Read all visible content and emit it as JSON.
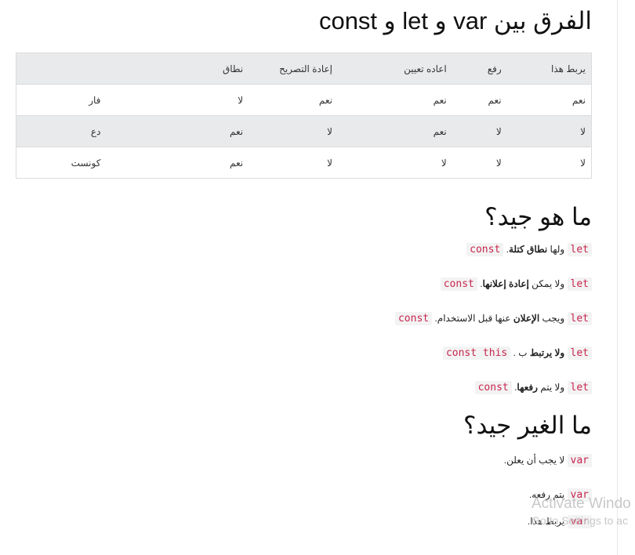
{
  "title": "الفرق بين var و let و const",
  "table": {
    "headers": [
      "يربط هذا",
      "رفع",
      "اعاده تعيين",
      "إعادة التصريح",
      "نطاق",
      ""
    ],
    "rows": [
      [
        "نعم",
        "نعم",
        "نعم",
        "نعم",
        "لا",
        "فار"
      ],
      [
        "لا",
        "لا",
        "نعم",
        "لا",
        "نعم",
        "دع"
      ],
      [
        "لا",
        "لا",
        "لا",
        "لا",
        "نعم",
        "كونست"
      ]
    ]
  },
  "good": {
    "heading": "ما هو جيد؟",
    "items": [
      {
        "code1": "let",
        "pre": " ولها ",
        "bold": "نطاق كتلة",
        "post": ". ",
        "code2": "const"
      },
      {
        "code1": "let",
        "pre": " ولا يمكن ",
        "bold": "إعادة إعلانها",
        "post": ". ",
        "code2": "const"
      },
      {
        "code1": "let",
        "pre": " ويجب ",
        "bold": "الإعلان",
        "post": " عنها قبل الاستخدام. ",
        "code2": "const"
      },
      {
        "code1": "let",
        "pre": " ",
        "bold": "ولا يرتبط",
        "post": " ب . ",
        "code2": "const this"
      },
      {
        "code1": "let",
        "pre": " ولا يتم ",
        "bold": "رفعها",
        "post": ". ",
        "code2": "const"
      }
    ]
  },
  "bad": {
    "heading": "ما الغير جيد؟",
    "items": [
      {
        "code": "var",
        "text": " لا يجب أن يعلن."
      },
      {
        "code": "var",
        "text": " يتم رفعه."
      },
      {
        "code": "var",
        "text": " يربط هذا."
      }
    ]
  },
  "watermark": {
    "line1": "Activate Windo",
    "line2": "Go to Settings to ac"
  }
}
